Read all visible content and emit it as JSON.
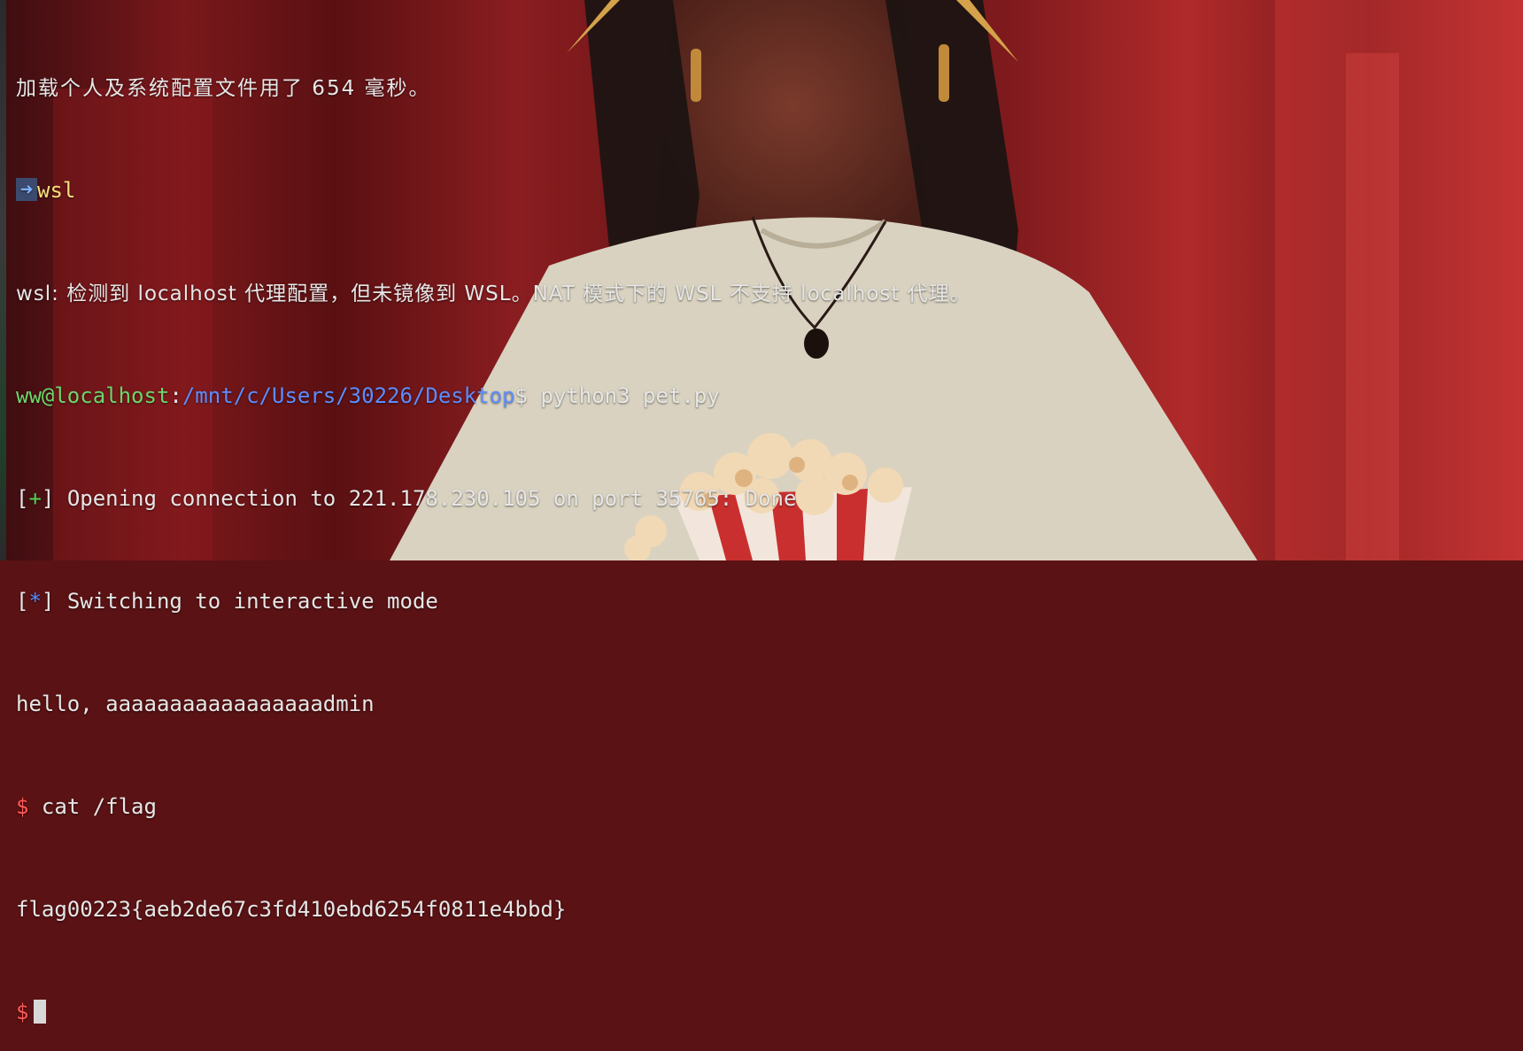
{
  "terminal": {
    "profile_load": "加载个人及系统配置文件用了 654 毫秒。",
    "prompt_arrow": "➜",
    "prompt_cmd": "wsl",
    "wsl_warning": "wsl: 检测到 localhost 代理配置，但未镜像到 WSL。NAT 模式下的 WSL 不支持 localhost 代理。",
    "user_host": "ww@localhost",
    "colon": ":",
    "cwd": "/mnt/c/Users/30226/Desktop",
    "shell_prompt": "$",
    "run_cmd": "python3 pet.py",
    "info_plus_mark": "+",
    "info_plus_text": "Opening connection to 221.178.230.105 on port 35765: Done",
    "info_star_mark": "*",
    "info_star_text": "Switching to interactive mode",
    "hello_line": "hello, aaaaaaaaaaaaaaaaadmin",
    "remote_prompt": "$",
    "remote_cmd": "cat /flag",
    "flag_line": "flag00223{aeb2de67c3fd410ebd6254f0811e4bbd}",
    "final_prompt": "$"
  },
  "colors": {
    "background_red": "#5a1214",
    "text": "#e6e6e6",
    "user_host": "#6bd66b",
    "path": "#5c8dff",
    "prompt_dollar": "#ff5a5a",
    "wsl_cmd": "#f3e07a"
  }
}
